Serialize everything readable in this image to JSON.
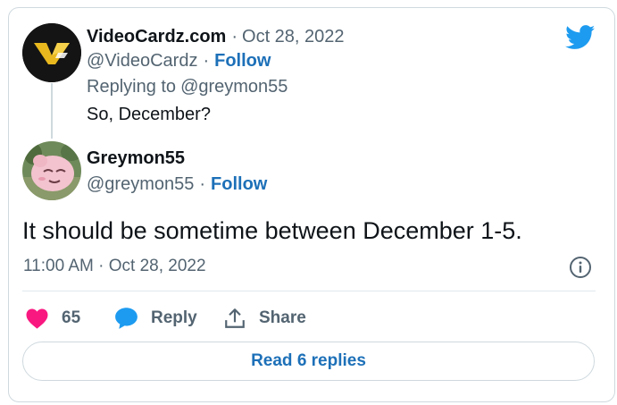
{
  "parent_tweet": {
    "display_name": "VideoCardz.com",
    "date_sep": "·",
    "date": "Oct 28, 2022",
    "handle": "@VideoCardz",
    "follow_sep": "·",
    "follow_label": "Follow",
    "replying_prefix": "Replying to",
    "replying_to": "@greymon55",
    "text": "So, December?",
    "avatar_initials": "VC"
  },
  "main_tweet": {
    "display_name": "Greymon55",
    "handle": "@greymon55",
    "follow_sep": "·",
    "follow_label": "Follow",
    "text": "It should be sometime between December 1-5.",
    "timestamp": "11:00 AM · Oct 28, 2022"
  },
  "actions": {
    "like_count": "65",
    "reply_label": "Reply",
    "share_label": "Share"
  },
  "read_replies_label": "Read 6 replies",
  "colors": {
    "twitter_blue": "#1d9bf0",
    "link_blue": "#1d70b8",
    "like_pink": "#f91880",
    "muted": "#536471"
  },
  "icons": {
    "brand": "twitter-bird-icon",
    "info": "info-icon",
    "like": "heart-icon",
    "reply": "speech-bubble-icon",
    "share": "share-icon"
  }
}
